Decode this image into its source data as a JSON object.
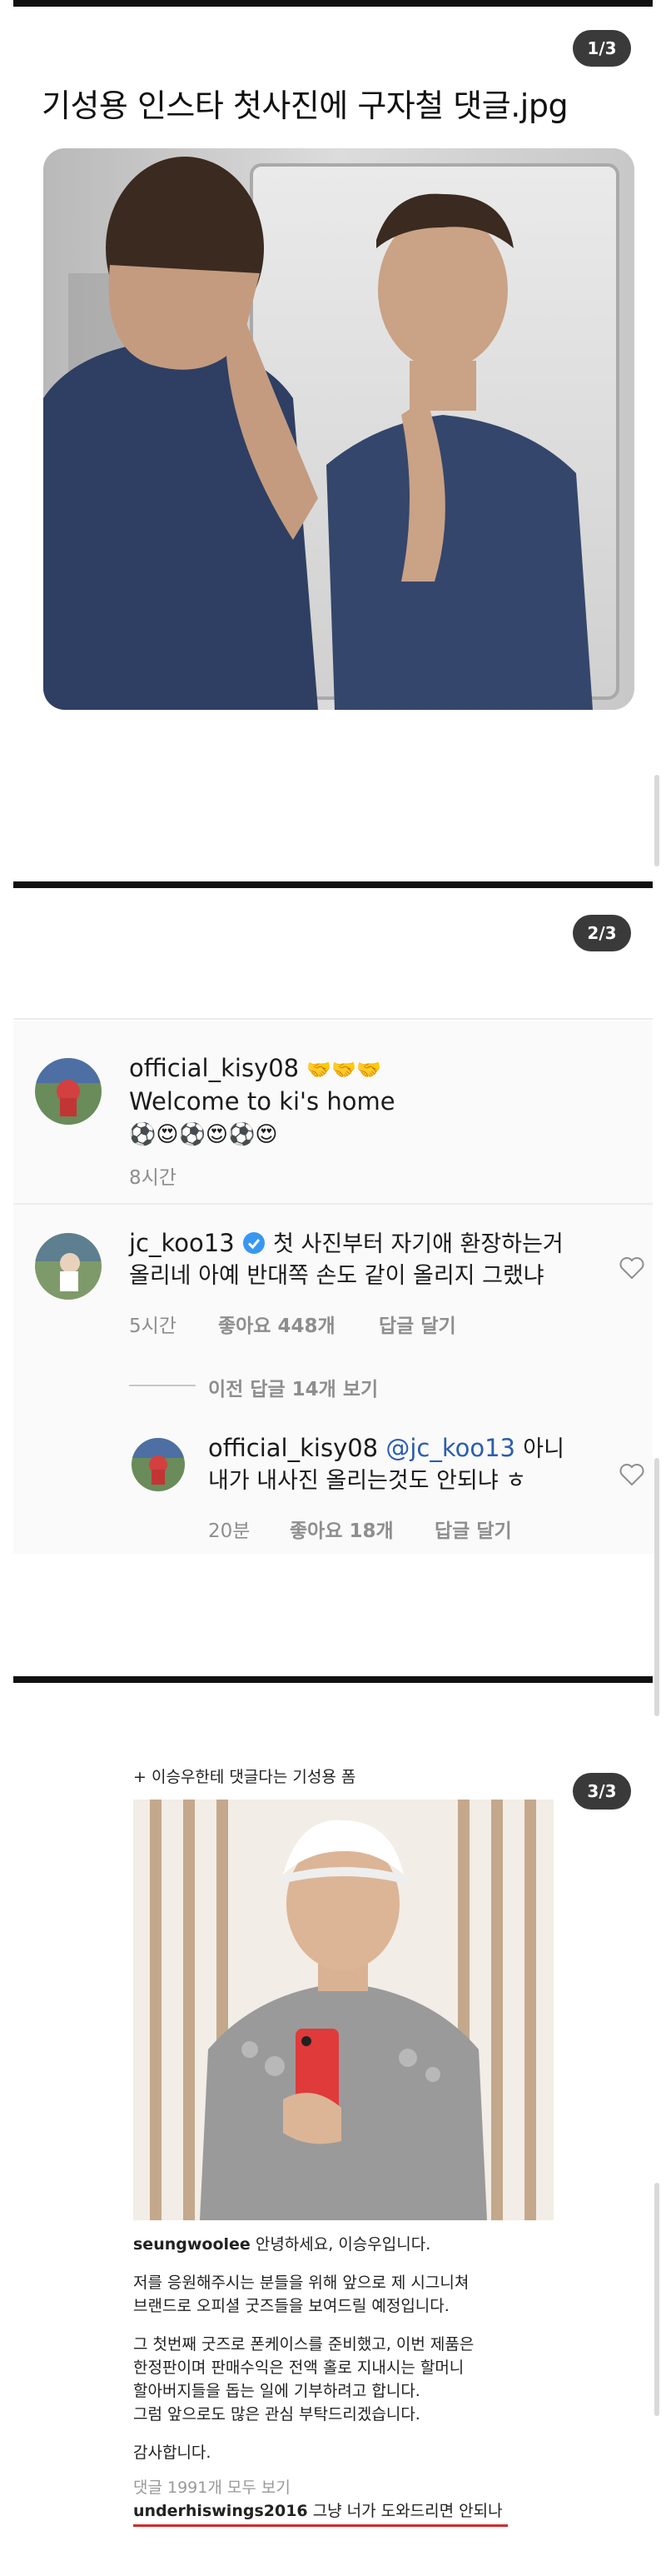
{
  "section1": {
    "badge": "1/3",
    "title": "기성용 인스타 첫사진에 구자철 댓글.jpg"
  },
  "section2": {
    "badge": "2/3",
    "comment1": {
      "username": "official_kisy08",
      "emoji_line1": "🤝🤝🤝",
      "text": "Welcome to ki's home",
      "emoji_line2": "⚽😍⚽😍⚽😍",
      "time": "8시간"
    },
    "comment2": {
      "username": "jc_koo13",
      "text_line1": "첫 사진부터 자기애 환장하는거",
      "text_line2": "올리네 아예 반대쪽 손도 같이 올리지 그랬냐",
      "time": "5시간",
      "likes": "좋아요 448개",
      "reply": "답글 달기",
      "view_replies": "이전 답글 14개 보기"
    },
    "comment3": {
      "username": "official_kisy08",
      "mention": "@jc_koo13",
      "text_line1": "아니",
      "text_line2": "내가 내사진 올리는것도 안되냐 ㅎ",
      "time": "20분",
      "likes": "좋아요 18개",
      "reply": "답글 달기"
    }
  },
  "section3": {
    "badge": "3/3",
    "caption": "+ 이승우한테 댓글다는 기성용 폼",
    "post_user": "seungwoolee",
    "post_line1": "안녕하세요, 이승우입니다.",
    "post_line2": "저를 응원해주시는 분들을 위해 앞으로 제 시그니쳐",
    "post_line3": "브랜드로 오피셜 굿즈들을 보여드릴 예정입니다.",
    "post_line4": "그 첫번째 굿즈로 폰케이스를 준비했고, 이번 제품은",
    "post_line5": "한정판이며 판매수익은 전액 홀로 지내시는 할머니",
    "post_line6": "할아버지들을 돕는 일에 기부하려고 합니다.",
    "post_line7": "그럼 앞으로도 많은 관심 부탁드리겠습니다.",
    "post_line8": "감사합니다.",
    "comments_count": "댓글 1991개 모두 보기",
    "reply_user": "underhiswings2016",
    "reply_text": "그냥 너가 도와드리면 안되나"
  },
  "colors": {
    "badge_bg": "#3a3a3a",
    "mention": "#2a5db0",
    "meta_gray": "#8e8e8e",
    "underline_red": "#d22b2b",
    "verified_blue": "#3897f0"
  }
}
